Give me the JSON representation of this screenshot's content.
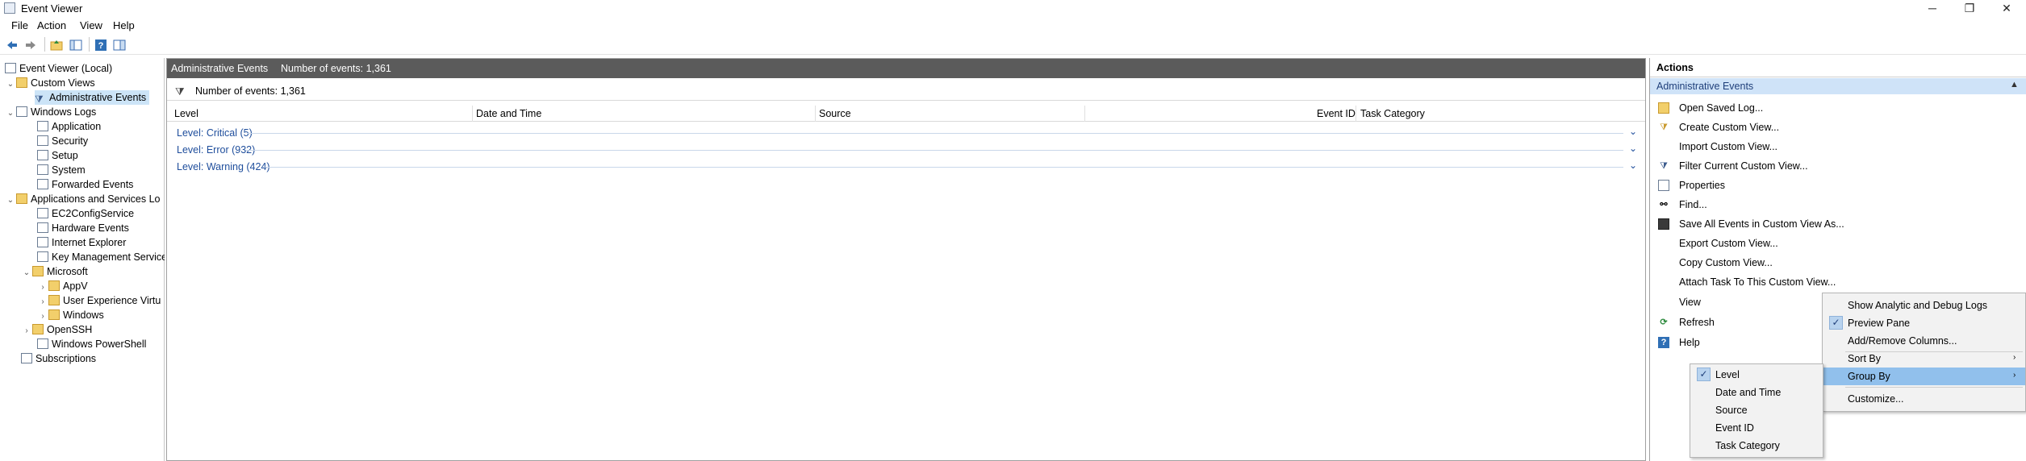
{
  "window": {
    "title": "Event Viewer",
    "minimize": "─",
    "restore": "❐",
    "close": "✕"
  },
  "menu": [
    "File",
    "Action",
    "View",
    "Help"
  ],
  "toolbar": [
    "back-icon",
    "forward-icon",
    "folder-up-icon",
    "show-hide-console-tree-icon",
    "help-icon",
    "show-hide-action-pane-icon"
  ],
  "tree": {
    "root": "Event Viewer (Local)",
    "custom_views": "Custom Views",
    "admin_events": "Administrative Events",
    "windows_logs": "Windows Logs",
    "windows_logs_items": [
      "Application",
      "Security",
      "Setup",
      "System",
      "Forwarded Events"
    ],
    "apps_services": "Applications and Services Lo",
    "apps_items": [
      "EC2ConfigService",
      "Hardware Events",
      "Internet Explorer",
      "Key Management Service"
    ],
    "microsoft": "Microsoft",
    "microsoft_items": [
      "AppV",
      "User Experience Virtu",
      "Windows"
    ],
    "openssh": "OpenSSH",
    "powershell": "Windows PowerShell",
    "subscriptions": "Subscriptions"
  },
  "center": {
    "header_title": "Administrative Events",
    "header_count": "Number of events: 1,361",
    "count_text": "Number of events: 1,361",
    "columns": {
      "level": "Level",
      "date": "Date and Time",
      "source": "Source",
      "event_id": "Event ID",
      "task": "Task Category"
    },
    "groups": [
      "Level: Critical (5)",
      "Level: Error (932)",
      "Level: Warning (424)"
    ]
  },
  "actions": {
    "header": "Actions",
    "section": "Administrative Events",
    "items": [
      "Open Saved Log...",
      "Create Custom View...",
      "Import Custom View...",
      "Filter Current Custom View...",
      "Properties",
      "Find...",
      "Save All Events in Custom View As...",
      "Export Custom View...",
      "Copy Custom View...",
      "Attach Task To This Custom View...",
      "View",
      "Refresh",
      "Help"
    ]
  },
  "view_menu": {
    "items": [
      "Show Analytic and Debug Logs",
      "Preview Pane",
      "Add/Remove Columns...",
      "Sort By",
      "Group By",
      "Customize..."
    ],
    "checked": "Preview Pane",
    "highlighted": "Group By"
  },
  "groupby_menu": {
    "items": [
      "Level",
      "Date and Time",
      "Source",
      "Event ID",
      "Task Category"
    ],
    "checked": "Level"
  },
  "colors": {
    "accent_blue": "#1f4e9c",
    "header_gray": "#5b5b5b",
    "selection": "#cce4f7",
    "menu_highlight": "#91c0ec"
  }
}
